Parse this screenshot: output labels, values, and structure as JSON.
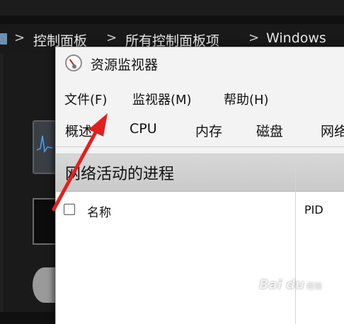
{
  "explorer": {
    "breadcrumbs": [
      "控制面板",
      "所有控制面板项",
      "Windows"
    ],
    "separator": ">"
  },
  "window": {
    "title": "资源监视器",
    "icon": "resource-monitor-icon"
  },
  "menu": {
    "items": [
      "文件(F)",
      "监视器(M)",
      "帮助(H)"
    ]
  },
  "tabs": {
    "items": [
      "概述",
      "CPU",
      "内存",
      "磁盘",
      "网络"
    ]
  },
  "panel": {
    "title": "网络活动的进程",
    "columns": {
      "name": "名称",
      "pid": "PID"
    }
  },
  "annotation": {
    "arrow_color": "#e02020"
  },
  "watermark": {
    "brand": "Bai du",
    "sub": "经验"
  }
}
